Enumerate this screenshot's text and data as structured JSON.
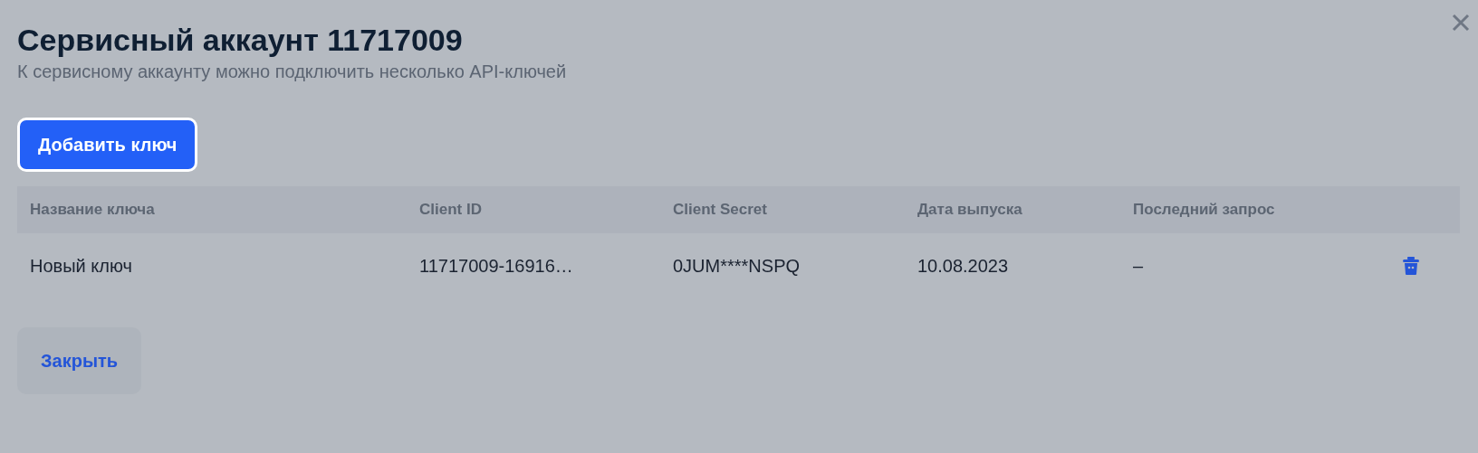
{
  "dialog": {
    "title": "Сервисный аккаунт 11717009",
    "subtitle": "К сервисному аккаунту можно подключить несколько API-ключей",
    "add_button": "Добавить ключ",
    "close_button": "Закрыть"
  },
  "table": {
    "columns": [
      "Название ключа",
      "Client ID",
      "Client Secret",
      "Дата выпуска",
      "Последний запрос"
    ],
    "rows": [
      {
        "cells": [
          "Новый ключ",
          "11717009-16916…",
          "0JUM****NSPQ",
          "10.08.2023",
          "–"
        ]
      }
    ]
  }
}
